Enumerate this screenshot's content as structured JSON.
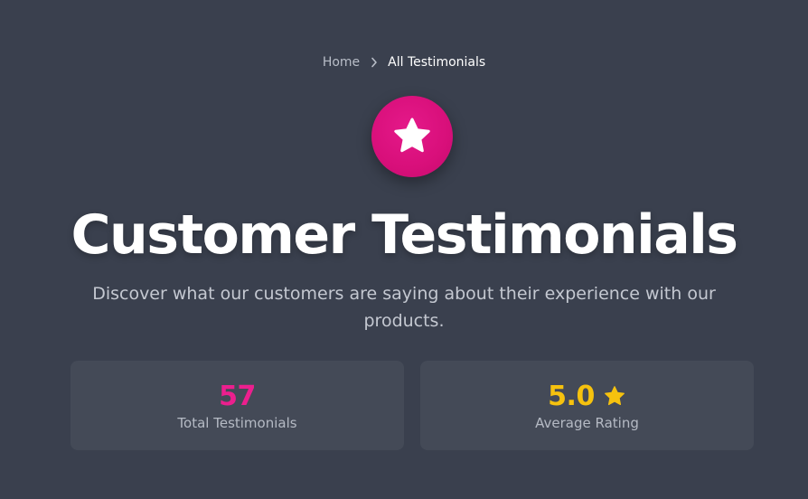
{
  "breadcrumb": {
    "home": "Home",
    "separator_icon": "chevron-right-icon",
    "current": "All Testimonials"
  },
  "hero": {
    "icon": "star-icon",
    "badge_color": "#d80f7a",
    "title": "Customer Testimonials",
    "subtitle": "Discover what our customers are saying about their experience with our products."
  },
  "stats": [
    {
      "value": "57",
      "label": "Total Testimonials",
      "value_color": "#ec1f8e"
    },
    {
      "value": "5.0",
      "label": "Average Rating",
      "value_color": "#f6c20e",
      "icon": "star-icon"
    }
  ],
  "colors": {
    "background": "#3a404e",
    "card": "#444a57",
    "accent_pink": "#ec1f8e",
    "accent_gold": "#f6c20e"
  }
}
